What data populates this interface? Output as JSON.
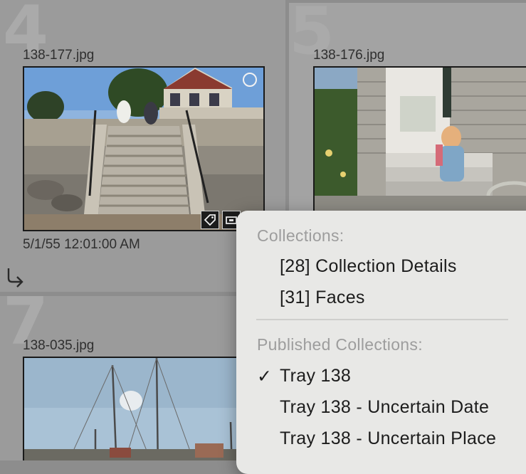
{
  "grid": {
    "cells": [
      {
        "number": "4",
        "filename": "138-177.jpg",
        "datetime": "5/1/55 12:01:00 AM"
      },
      {
        "number": "5",
        "filename": "138-176.jpg"
      },
      {
        "number": "7",
        "filename": "138-035.jpg"
      }
    ]
  },
  "context_menu": {
    "collections_header": "Collections:",
    "collections": [
      "[28] Collection Details",
      "[31] Faces"
    ],
    "published_header": "Published Collections:",
    "published": [
      {
        "label": "Tray 138",
        "checked": true
      },
      {
        "label": "Tray 138 - Uncertain Date",
        "checked": false
      },
      {
        "label": "Tray 138 - Uncertain Place",
        "checked": false
      }
    ],
    "check_glyph": "✓"
  },
  "icons": [
    "keyword-tag-icon",
    "collection-badge-icon",
    "rotate-icon",
    "select-circle-icon"
  ]
}
